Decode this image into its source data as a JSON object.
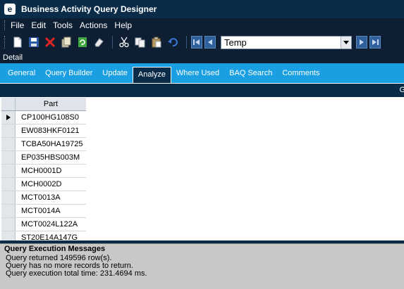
{
  "window": {
    "title": "Business Activity Query Designer",
    "app_icon": "e"
  },
  "menubar": {
    "items": [
      {
        "label": "File"
      },
      {
        "label": "Edit"
      },
      {
        "label": "Tools"
      },
      {
        "label": "Actions"
      },
      {
        "label": "Help"
      }
    ]
  },
  "toolbar": {
    "buttons": [
      "new-icon",
      "save-icon",
      "delete-icon",
      "copy-record-icon",
      "refresh-icon",
      "clear-icon",
      "cut-icon",
      "copy-icon",
      "paste-icon",
      "undo-icon"
    ],
    "combo_value": "Temp",
    "colors": {
      "accent": "#1a9fe2",
      "dark": "#0a2c49"
    }
  },
  "detail": {
    "label": "Detail"
  },
  "tabs": [
    {
      "label": "General"
    },
    {
      "label": "Query Builder"
    },
    {
      "label": "Update"
    },
    {
      "label": "Analyze"
    },
    {
      "label": "Where Used"
    },
    {
      "label": "BAQ Search"
    },
    {
      "label": "Comments"
    }
  ],
  "band": {
    "label": "G"
  },
  "grid": {
    "column": "Part",
    "rows": [
      "CP100HG108S0",
      "EW083HKF0121",
      "TCBA50HA19725",
      "EP035HBS003M",
      "MCH0001D",
      "MCH0002D",
      "MCT0013A",
      "MCT0014A",
      "MCT0024L122A",
      "ST20E14A147G"
    ]
  },
  "messages": {
    "title": "Query Execution Messages",
    "lines": [
      "Query returned 149596 row(s).",
      "Query has no more records to return.",
      "Query execution total time: 231.4694 ms."
    ]
  }
}
